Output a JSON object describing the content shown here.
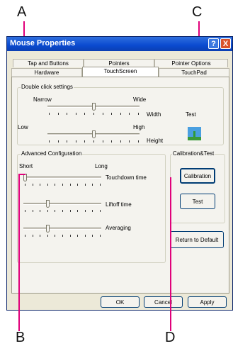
{
  "callouts": {
    "a": "A",
    "b": "B",
    "c": "C",
    "d": "D"
  },
  "window": {
    "title": "Mouse Properties",
    "help_glyph": "?",
    "close_glyph": "X"
  },
  "tabs": {
    "row1": [
      "Tap and Buttons",
      "Pointers",
      "Pointer Options"
    ],
    "row2": [
      "Hardware",
      "TouchScreen",
      "TouchPad"
    ],
    "active": "TouchScreen"
  },
  "double_click": {
    "legend": "Double click settings",
    "width_left": "Narrow",
    "width_right": "Wide",
    "width_label": "Width",
    "width_level": 0.5,
    "height_left": "Low",
    "height_right": "High",
    "height_label": "Height",
    "height_level": 0.5,
    "test_label": "Test"
  },
  "advanced": {
    "legend": "Advanced Configuration",
    "short": "Short",
    "long": "Long",
    "touchdown_label": "Touchdown time",
    "touchdown_level": 0.0,
    "liftoff_label": "Liftoff time",
    "liftoff_level": 0.3,
    "averaging_label": "Averaging",
    "averaging_level": 0.3
  },
  "calibration": {
    "legend": "Calibration&Test",
    "calibration_button": "Calibration",
    "test_button": "Test"
  },
  "return_default": "Return to Default",
  "footer": {
    "ok": "OK",
    "cancel": "Cancel",
    "apply": "Apply"
  }
}
